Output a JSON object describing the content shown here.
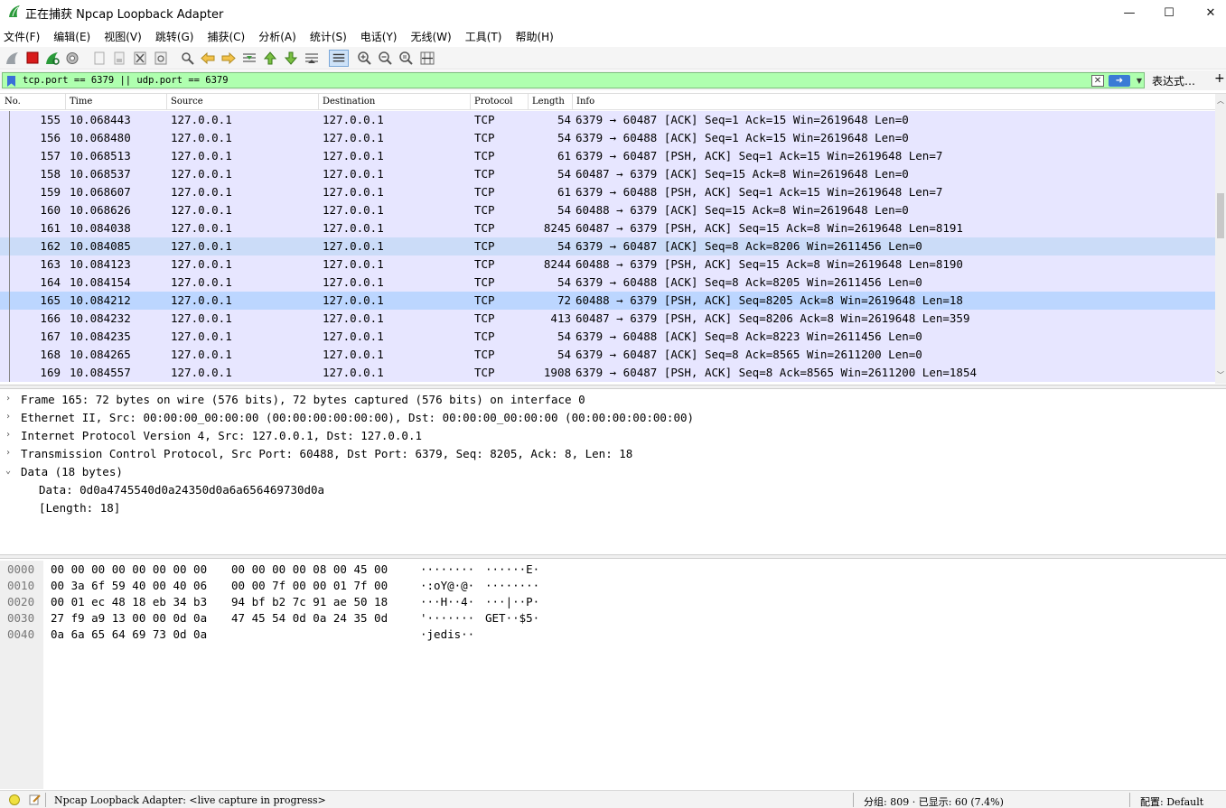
{
  "window": {
    "title": "正在捕获 Npcap Loopback Adapter",
    "minimize": "—",
    "maximize": "☐",
    "close": "✕"
  },
  "menu": [
    "文件(F)",
    "编辑(E)",
    "视图(V)",
    "跳转(G)",
    "捕获(C)",
    "分析(A)",
    "统计(S)",
    "电话(Y)",
    "无线(W)",
    "工具(T)",
    "帮助(H)"
  ],
  "filter": {
    "value": "tcp.port == 6379 || udp.port == 6379",
    "clear_glyph": "✕",
    "apply_glyph": "➜",
    "dropdown_glyph": "▼",
    "expression_label": "表达式…",
    "add_glyph": "+"
  },
  "packet_list": {
    "columns": [
      "No.",
      "Time",
      "Source",
      "Destination",
      "Protocol",
      "Length",
      "Info"
    ],
    "rows": [
      {
        "no": "155",
        "time": "10.068443",
        "src": "127.0.0.1",
        "dst": "127.0.0.1",
        "proto": "TCP",
        "len": "54",
        "info": "6379 → 60487 [ACK] Seq=1 Ack=15 Win=2619648 Len=0"
      },
      {
        "no": "156",
        "time": "10.068480",
        "src": "127.0.0.1",
        "dst": "127.0.0.1",
        "proto": "TCP",
        "len": "54",
        "info": "6379 → 60488 [ACK] Seq=1 Ack=15 Win=2619648 Len=0"
      },
      {
        "no": "157",
        "time": "10.068513",
        "src": "127.0.0.1",
        "dst": "127.0.0.1",
        "proto": "TCP",
        "len": "61",
        "info": "6379 → 60487 [PSH, ACK] Seq=1 Ack=15 Win=2619648 Len=7"
      },
      {
        "no": "158",
        "time": "10.068537",
        "src": "127.0.0.1",
        "dst": "127.0.0.1",
        "proto": "TCP",
        "len": "54",
        "info": "60487 → 6379 [ACK] Seq=15 Ack=8 Win=2619648 Len=0"
      },
      {
        "no": "159",
        "time": "10.068607",
        "src": "127.0.0.1",
        "dst": "127.0.0.1",
        "proto": "TCP",
        "len": "61",
        "info": "6379 → 60488 [PSH, ACK] Seq=1 Ack=15 Win=2619648 Len=7"
      },
      {
        "no": "160",
        "time": "10.068626",
        "src": "127.0.0.1",
        "dst": "127.0.0.1",
        "proto": "TCP",
        "len": "54",
        "info": "60488 → 6379 [ACK] Seq=15 Ack=8 Win=2619648 Len=0"
      },
      {
        "no": "161",
        "time": "10.084038",
        "src": "127.0.0.1",
        "dst": "127.0.0.1",
        "proto": "TCP",
        "len": "8245",
        "info": "60487 → 6379 [PSH, ACK] Seq=15 Ack=8 Win=2619648 Len=8191"
      },
      {
        "no": "162",
        "time": "10.084085",
        "src": "127.0.0.1",
        "dst": "127.0.0.1",
        "proto": "TCP",
        "len": "54",
        "info": "6379 → 60487 [ACK] Seq=8 Ack=8206 Win=2611456 Len=0"
      },
      {
        "no": "163",
        "time": "10.084123",
        "src": "127.0.0.1",
        "dst": "127.0.0.1",
        "proto": "TCP",
        "len": "8244",
        "info": "60488 → 6379 [PSH, ACK] Seq=15 Ack=8 Win=2619648 Len=8190"
      },
      {
        "no": "164",
        "time": "10.084154",
        "src": "127.0.0.1",
        "dst": "127.0.0.1",
        "proto": "TCP",
        "len": "54",
        "info": "6379 → 60488 [ACK] Seq=8 Ack=8205 Win=2611456 Len=0"
      },
      {
        "no": "165",
        "time": "10.084212",
        "src": "127.0.0.1",
        "dst": "127.0.0.1",
        "proto": "TCP",
        "len": "72",
        "info": "60488 → 6379 [PSH, ACK] Seq=8205 Ack=8 Win=2619648 Len=18"
      },
      {
        "no": "166",
        "time": "10.084232",
        "src": "127.0.0.1",
        "dst": "127.0.0.1",
        "proto": "TCP",
        "len": "413",
        "info": "60487 → 6379 [PSH, ACK] Seq=8206 Ack=8 Win=2619648 Len=359"
      },
      {
        "no": "167",
        "time": "10.084235",
        "src": "127.0.0.1",
        "dst": "127.0.0.1",
        "proto": "TCP",
        "len": "54",
        "info": "6379 → 60488 [ACK] Seq=8 Ack=8223 Win=2611456 Len=0"
      },
      {
        "no": "168",
        "time": "10.084265",
        "src": "127.0.0.1",
        "dst": "127.0.0.1",
        "proto": "TCP",
        "len": "54",
        "info": "6379 → 60487 [ACK] Seq=8 Ack=8565 Win=2611200 Len=0"
      },
      {
        "no": "169",
        "time": "10.084557",
        "src": "127.0.0.1",
        "dst": "127.0.0.1",
        "proto": "TCP",
        "len": "1908",
        "info": "6379 → 60487 [PSH, ACK] Seq=8 Ack=8565 Win=2611200 Len=1854"
      }
    ],
    "selected_no": "165",
    "hover_no": "162",
    "row_color": "#e7e6ff",
    "selected_color": "#bcd6ff"
  },
  "details": [
    {
      "arrow": "›",
      "text": "Frame 165: 72 bytes on wire (576 bits), 72 bytes captured (576 bits) on interface 0",
      "indent": 0
    },
    {
      "arrow": "›",
      "text": "Ethernet II, Src: 00:00:00_00:00:00 (00:00:00:00:00:00), Dst: 00:00:00_00:00:00 (00:00:00:00:00:00)",
      "indent": 0
    },
    {
      "arrow": "›",
      "text": "Internet Protocol Version 4, Src: 127.0.0.1, Dst: 127.0.0.1",
      "indent": 0
    },
    {
      "arrow": "›",
      "text": "Transmission Control Protocol, Src Port: 60488, Dst Port: 6379, Seq: 8205, Ack: 8, Len: 18",
      "indent": 0
    },
    {
      "arrow": "⌄",
      "text": "Data (18 bytes)",
      "indent": 0
    },
    {
      "arrow": "",
      "text": "Data: 0d0a4745540d0a24350d0a6a656469730d0a",
      "indent": 1
    },
    {
      "arrow": "",
      "text": "[Length: 18]",
      "indent": 1
    }
  ],
  "bytes": [
    {
      "off": "0000",
      "hex1": "00 00 00 00 00 00 00 00",
      "hex2": "00 00 00 00 08 00 45 00",
      "asc1": "········",
      "asc2": "······E·"
    },
    {
      "off": "0010",
      "hex1": "00 3a 6f 59 40 00 40 06",
      "hex2": "00 00 7f 00 00 01 7f 00",
      "asc1": "·:oY@·@·",
      "asc2": "········"
    },
    {
      "off": "0020",
      "hex1": "00 01 ec 48 18 eb 34 b3",
      "hex2": "94 bf b2 7c 91 ae 50 18",
      "asc1": "···H··4·",
      "asc2": "···|··P·"
    },
    {
      "off": "0030",
      "hex1": "27 f9 a9 13 00 00 0d 0a",
      "hex2": "47 45 54 0d 0a 24 35 0d",
      "asc1": "'·······",
      "asc2": "GET··$5·"
    },
    {
      "off": "0040",
      "hex1": "0a 6a 65 64 69 73 0d 0a",
      "hex2": "",
      "asc1": "·jedis··",
      "asc2": ""
    }
  ],
  "status": {
    "capture_text": "Npcap Loopback Adapter: <live capture in progress>",
    "packets": "分组: 809 · 已显示: 60 (7.4%)",
    "profile": "配置: Default"
  }
}
